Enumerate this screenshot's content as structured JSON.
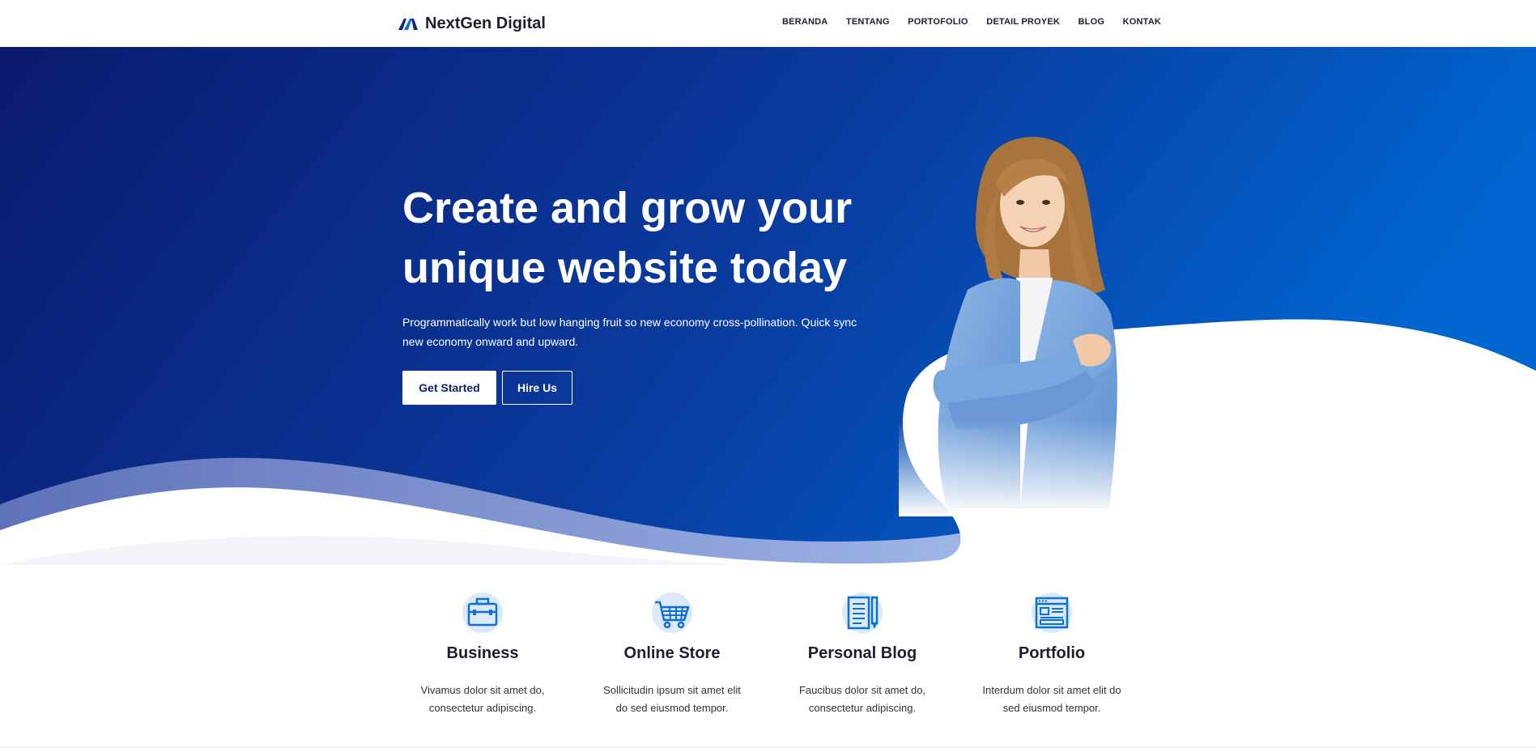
{
  "brand": {
    "name": "NextGen Digital",
    "logo_icon": "brand-logo-icon"
  },
  "nav": {
    "items": [
      "BERANDA",
      "TENTANG",
      "PORTOFOLIO",
      "DETAIL PROYEK",
      "BLOG",
      "KONTAK"
    ]
  },
  "hero": {
    "title": "Create and grow your unique website today",
    "subtitle": "Programmatically work but low hanging fruit so new economy cross-pollination. Quick sync new economy onward and upward.",
    "primary_button": "Get Started",
    "secondary_button": "Hire Us"
  },
  "features": [
    {
      "icon": "briefcase-icon",
      "title": "Business",
      "description": "Vivamus dolor sit amet do, consectetur adipiscing."
    },
    {
      "icon": "shopping-cart-icon",
      "title": "Online Store",
      "description": "Sollicitudin ipsum sit amet elit do sed eiusmod tempor."
    },
    {
      "icon": "document-pen-icon",
      "title": "Personal Blog",
      "description": "Faucibus dolor sit amet do, consectetur adipiscing."
    },
    {
      "icon": "browser-window-icon",
      "title": "Portfolio",
      "description": "Interdum dolor sit amet elit do sed eiusmod tempor."
    }
  ],
  "colors": {
    "hero_gradient_start": "#0b1a6e",
    "hero_gradient_end": "#0062cc",
    "accent": "#0d6fd8",
    "icon_bg": "#dbe9fa"
  }
}
